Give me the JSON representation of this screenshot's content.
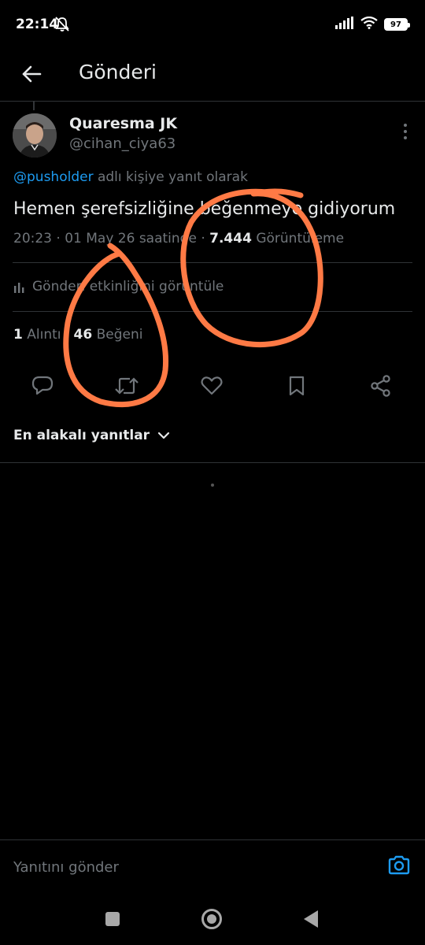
{
  "status_bar": {
    "time": "22:14",
    "battery": "97"
  },
  "header": {
    "title": "Gönderi"
  },
  "tweet": {
    "author_name": "Quaresma JK",
    "author_handle": "@cihan_ciya63",
    "reply_mention": "@pusholder",
    "reply_suffix": " adlı kişiye yanıt olarak",
    "text": "Hemen şerefsizliğine beğenmeye gidiyorum",
    "timestamp": "20:23 · 01 May 26 saatinde · ",
    "views": "7.444",
    "views_label": " Görüntüleme",
    "analytics_label": "Gönderi etkinliğini görüntüle",
    "quotes_count": "1",
    "quotes_label": "Alıntı",
    "likes_count": "46",
    "likes_label": "Beğeni"
  },
  "replies": {
    "sort_label": "En alakalı yanıtlar"
  },
  "reply_bar": {
    "placeholder": "Yanıtını gönder"
  },
  "colors": {
    "accent": "#1d9bf0",
    "annotation": "#ff7a45",
    "muted": "#71767b"
  }
}
